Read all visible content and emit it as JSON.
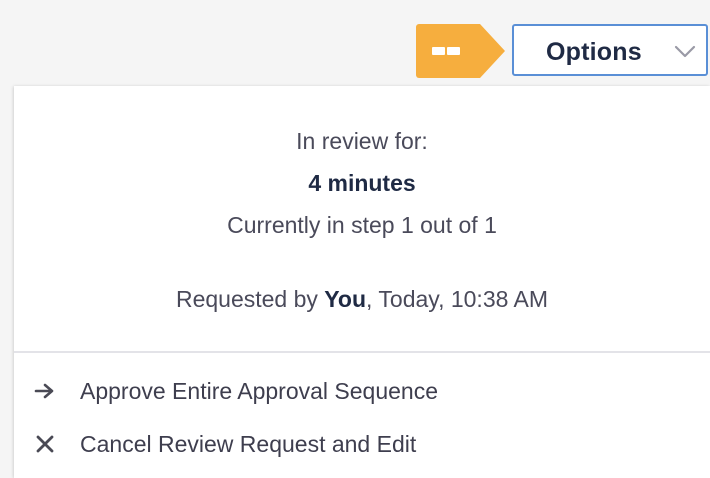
{
  "header": {
    "options_label": "Options",
    "accent_color": "#f6ae3e",
    "button_border_color": "#5a8fd6"
  },
  "icons": {
    "status_tag": "status-tag-icon",
    "options_chevron": "chevron-down-icon",
    "approve": "arrow-right-icon",
    "cancel": "close-icon"
  },
  "review": {
    "label": "In review for:",
    "duration": "4 minutes",
    "step_info": "Currently in step 1 out of 1",
    "requested_prefix": "Requested by ",
    "requested_by": "You",
    "requested_time": ", Today, 10:38 AM"
  },
  "menu": {
    "items": [
      {
        "label": "Approve Entire Approval Sequence",
        "icon": "arrow-right-icon"
      },
      {
        "label": "Cancel Review Request and Edit",
        "icon": "close-icon"
      }
    ]
  }
}
